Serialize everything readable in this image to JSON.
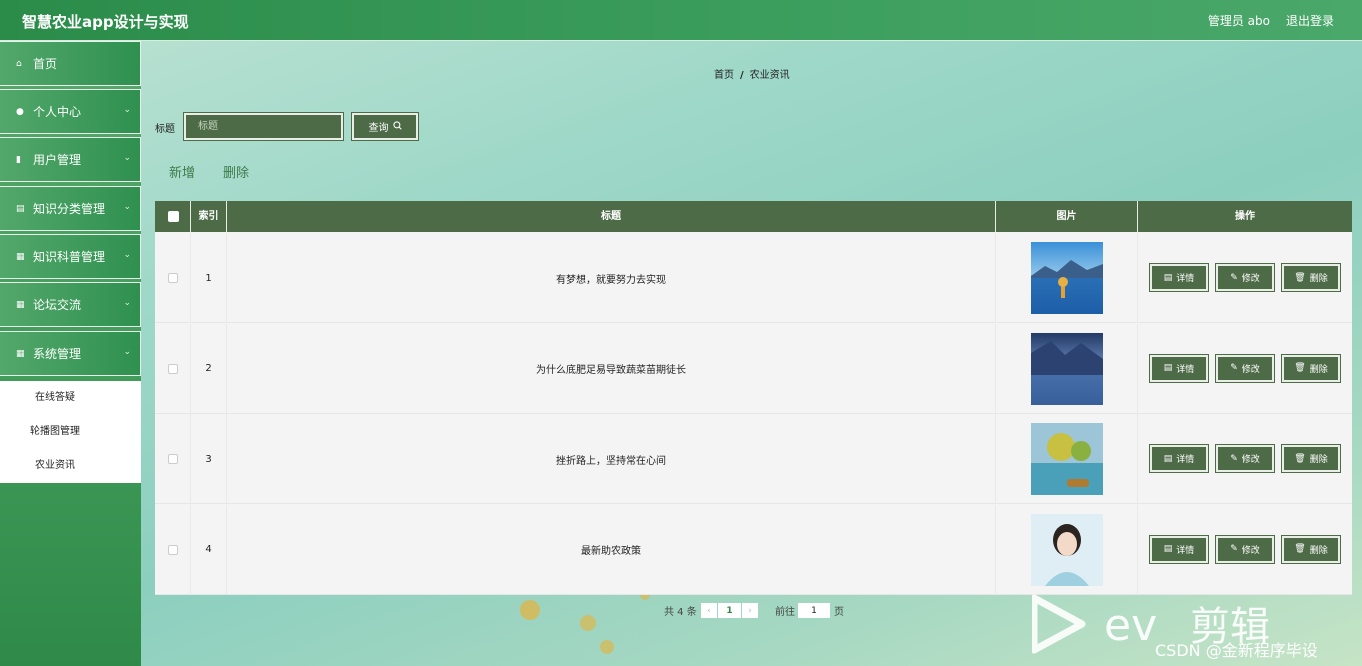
{
  "header": {
    "app_title": "智慧农业app设计与实现",
    "admin_label": "管理员 abo",
    "logout_label": "退出登录"
  },
  "sidebar": {
    "items": [
      {
        "label": "首页",
        "icon": "home-icon",
        "chevron": false
      },
      {
        "label": "个人中心",
        "icon": "user-icon",
        "chevron": true
      },
      {
        "label": "用户管理",
        "icon": "user-manage-icon",
        "chevron": true
      },
      {
        "label": "知识分类管理",
        "icon": "clipboard-icon",
        "chevron": true
      },
      {
        "label": "知识科普管理",
        "icon": "grid-icon",
        "chevron": true
      },
      {
        "label": "论坛交流",
        "icon": "grid-icon",
        "chevron": true
      },
      {
        "label": "系统管理",
        "icon": "apps-icon",
        "chevron": true
      }
    ],
    "submenu": [
      "在线答疑",
      "轮播图管理",
      "农业资讯"
    ]
  },
  "breadcrumb": {
    "home": "首页",
    "separator": "/",
    "current": "农业资讯"
  },
  "search": {
    "label": "标题",
    "placeholder": "标题",
    "button_label": "查询"
  },
  "actions": {
    "add_label": "新增",
    "delete_label": "删除"
  },
  "table": {
    "headers": [
      "索引",
      "标题",
      "图片",
      "操作"
    ],
    "rows": [
      {
        "index": "1",
        "title": "有梦想，就要努力去实现"
      },
      {
        "index": "2",
        "title": "为什么底肥足易导致蔬菜苗期徒长"
      },
      {
        "index": "3",
        "title": "挫折路上，坚持常在心间"
      },
      {
        "index": "4",
        "title": "最新助农政策"
      }
    ],
    "row_actions": {
      "detail": "详情",
      "edit": "修改",
      "delete": "删除"
    }
  },
  "pagination": {
    "total": "共 4 条",
    "current_page": "1",
    "goto_label": "前往",
    "goto_value": "1",
    "page_suffix": "页"
  },
  "overlay": {
    "watermark": "剪辑",
    "csdn": "CSDN @金新程序毕设"
  },
  "colors": {
    "header": "#2b8c4a",
    "button": "#4e6b47",
    "sidebar": "#3f9a58"
  }
}
